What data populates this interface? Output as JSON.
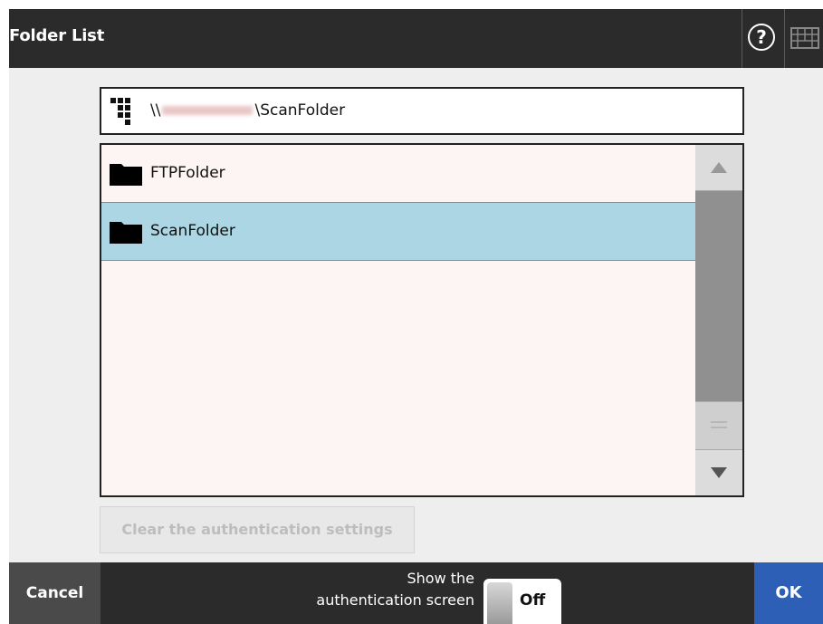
{
  "header": {
    "title": "Folder List",
    "help_glyph": "?",
    "help_icon": "help-icon",
    "keyboard_icon": "keyboard-icon"
  },
  "path": {
    "icon": "network-icon",
    "prefix": "\\\\",
    "suffix": "\\ScanFolder"
  },
  "folders": {
    "items": [
      {
        "name": "FTPFolder",
        "icon": "folder-icon",
        "selected": false
      },
      {
        "name": "ScanFolder",
        "icon": "folder-icon",
        "selected": true
      }
    ]
  },
  "scrollbar": {
    "up_icon": "arrow-up-icon",
    "down_icon": "arrow-down-icon"
  },
  "clear_button": {
    "label": "Clear the authentication settings",
    "enabled": false
  },
  "footer": {
    "cancel_label": "Cancel",
    "auth_label_line1": "Show the",
    "auth_label_line2": "authentication screen",
    "toggle_value": "Off",
    "ok_label": "OK"
  },
  "colors": {
    "header_bg": "#2b2b2b",
    "selected_row": "#acd6e4",
    "list_bg": "#fdf4f4",
    "ok_button": "#2d5fb6",
    "cancel_button": "#4a4a4a"
  }
}
